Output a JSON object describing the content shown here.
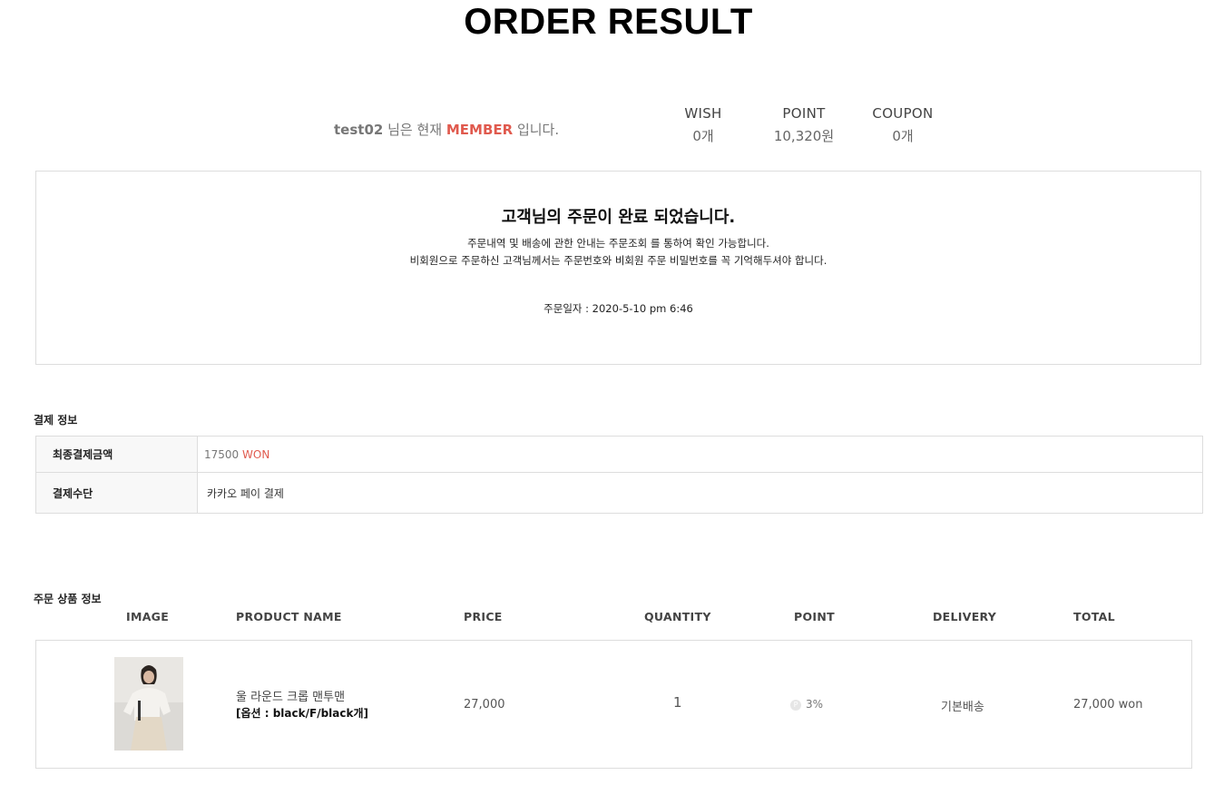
{
  "page": {
    "title": "ORDER RESULT"
  },
  "member": {
    "user_id": "test02",
    "text_mid": " 님은 현재 ",
    "grade": "MEMBER",
    "text_end": " 입니다."
  },
  "stats": [
    {
      "label": "WISH",
      "value": "0개"
    },
    {
      "label": "POINT",
      "value": "10,320원"
    },
    {
      "label": "COUPON",
      "value": "0개"
    }
  ],
  "complete": {
    "headline": "고객님의 주문이 완료 되었습니다.",
    "msg1": "주문내역 및 배송에 관한 안내는 주문조회 를 통하여 확인 가능합니다.",
    "msg2": "비회원으로 주문하신 고객님께서는 주문번호와 비회원 주문 비밀번호를 꼭 기억해두셔야 합니다.",
    "date_label": "주문일자 : ",
    "date_value": "2020-5-10 pm 6:46"
  },
  "payment": {
    "section_title": "결제 정보",
    "amount_label": "최종결제금액",
    "amount_value": "17500",
    "amount_unit": " WON",
    "method_label": "결제수단",
    "method_value": "카카오 페이 결제"
  },
  "products": {
    "section_title": "주문 상품 정보",
    "columns": [
      "IMAGE",
      "PRODUCT NAME",
      "PRICE",
      "QUANTITY",
      "POINT",
      "DELIVERY",
      "TOTAL"
    ],
    "items": [
      {
        "name": "울 라운드 크롭 맨투맨",
        "option": "[옵션 : black/F/black개]",
        "price": "27,000",
        "quantity": "1",
        "point_icon": "P",
        "point": "3%",
        "delivery": "기본배송",
        "total": "27,000 won"
      }
    ]
  },
  "colors": {
    "accent": "#e05a4e",
    "border": "#dddddd",
    "header_bg": "#f8f8f8"
  }
}
